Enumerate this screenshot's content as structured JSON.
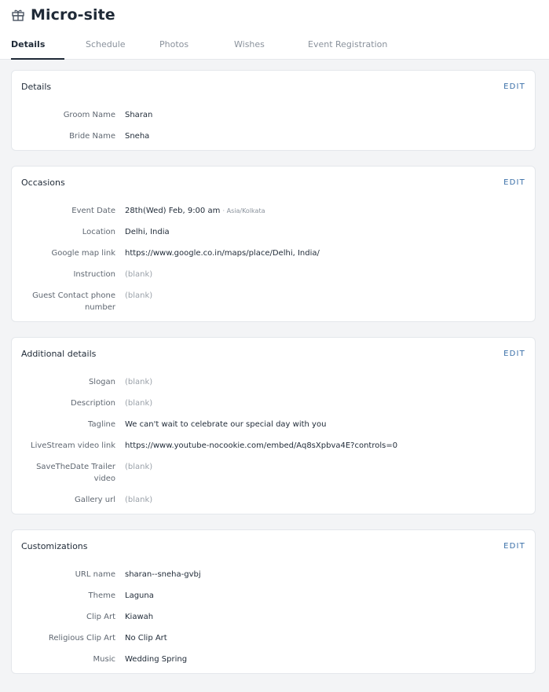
{
  "page_title": "Micro-site",
  "tabs": [
    {
      "label": "Details"
    },
    {
      "label": "Schedule"
    },
    {
      "label": "Photos"
    },
    {
      "label": "Wishes"
    },
    {
      "label": "Event Registration"
    }
  ],
  "active_tab": "Details",
  "edit_label": "EDIT",
  "cards": {
    "details": {
      "title": "Details",
      "rows": [
        {
          "label": "Groom Name",
          "value": "Sharan"
        },
        {
          "label": "Bride Name",
          "value": "Sneha"
        }
      ]
    },
    "occasions": {
      "title": "Occasions",
      "event_date": {
        "label": "Event Date",
        "value": "28th(Wed) Feb, 9:00 am",
        "timezone": "· Asia/Kolkata"
      },
      "rows": [
        {
          "label": "Location",
          "value": "Delhi, India"
        },
        {
          "label": "Google map link",
          "value": "https://www.google.co.in/maps/place/Delhi, India/"
        },
        {
          "label": "Instruction",
          "value": "(blank)"
        }
      ],
      "guest_contact": {
        "label_line1": "Guest Contact phone",
        "label_line2": "number",
        "value": "(blank)"
      }
    },
    "additional": {
      "title": "Additional details",
      "rows": [
        {
          "label": "Slogan",
          "value": "(blank)"
        },
        {
          "label": "Description",
          "value": "(blank)"
        },
        {
          "label": "Tagline",
          "value": "We can't wait to celebrate our special day with you"
        },
        {
          "label": "LiveStream video link",
          "value": "https://www.youtube-nocookie.com/embed/Aq8sXpbva4E?controls=0"
        }
      ],
      "trailer": {
        "label_line1": "SaveTheDate Trailer",
        "label_line2": "video",
        "value": "(blank)"
      },
      "gallery": {
        "label": "Gallery url",
        "value": "(blank)"
      }
    },
    "customizations": {
      "title": "Customizations",
      "rows": [
        {
          "label": "URL name",
          "value": "sharan--sneha-gvbj"
        },
        {
          "label": "Theme",
          "value": "Laguna"
        },
        {
          "label": "Clip Art",
          "value": "Kiawah"
        },
        {
          "label": "Religious Clip Art",
          "value": "No Clip Art"
        },
        {
          "label": "Music",
          "value": "Wedding Spring"
        }
      ]
    }
  },
  "icons": {
    "title_icon": "gift-icon"
  },
  "colors": {
    "accent": "#3a6fa8",
    "text": "#1f2a37",
    "muted": "#8a929c",
    "background": "#f3f4f6"
  }
}
